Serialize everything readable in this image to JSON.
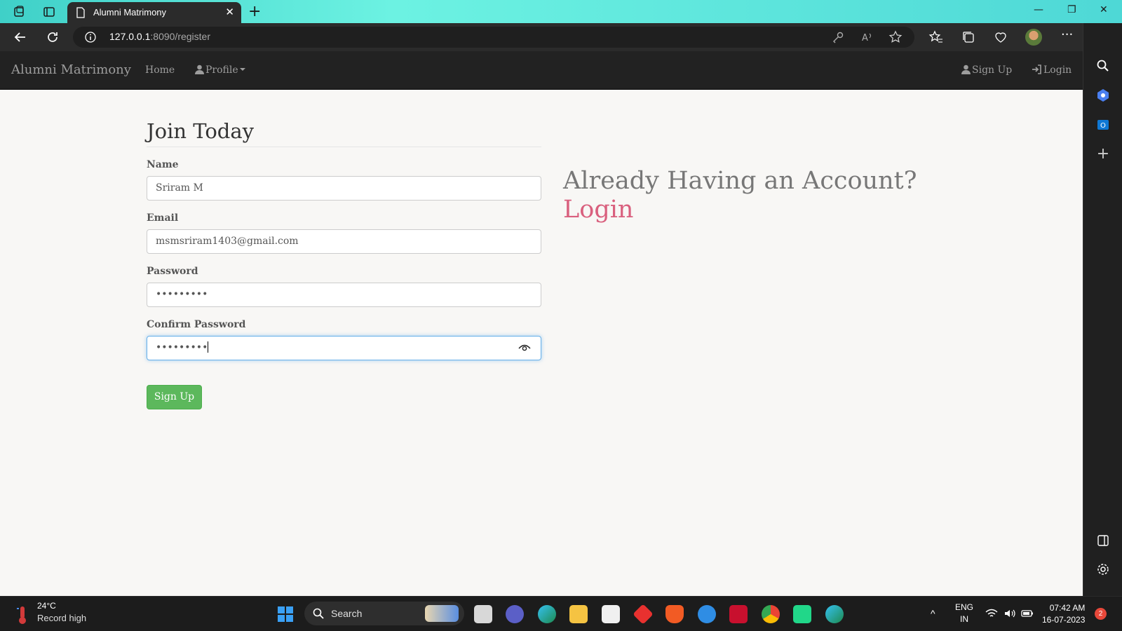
{
  "browser": {
    "tab_title": "Alumni Matrimony",
    "url_host": "127.0.0.1",
    "url_rest": ":8090/register"
  },
  "navbar": {
    "brand": "Alumni Matrimony",
    "home": "Home",
    "profile": "Profile",
    "signup": "Sign Up",
    "login": "Login"
  },
  "form": {
    "legend": "Join Today",
    "name_label": "Name",
    "name_value": "Sriram M",
    "email_label": "Email",
    "email_value": "msmsriram1403@gmail.com",
    "password_label": "Password",
    "password_value": "•••••••••",
    "confirm_label": "Confirm Password",
    "confirm_value": "•••••••••",
    "submit": "Sign Up"
  },
  "aside": {
    "question": "Already Having an Account?",
    "login_link": "Login"
  },
  "taskbar": {
    "temp": "24°C",
    "weather": "Record high",
    "search": "Search",
    "lang_top": "ENG",
    "lang_bottom": "IN",
    "time": "07:42 AM",
    "date": "16-07-2023",
    "notifications": "2"
  },
  "colors": {
    "accent_login": "#d9607e",
    "button_green": "#5cb85c",
    "navbar_bg": "#222222"
  }
}
